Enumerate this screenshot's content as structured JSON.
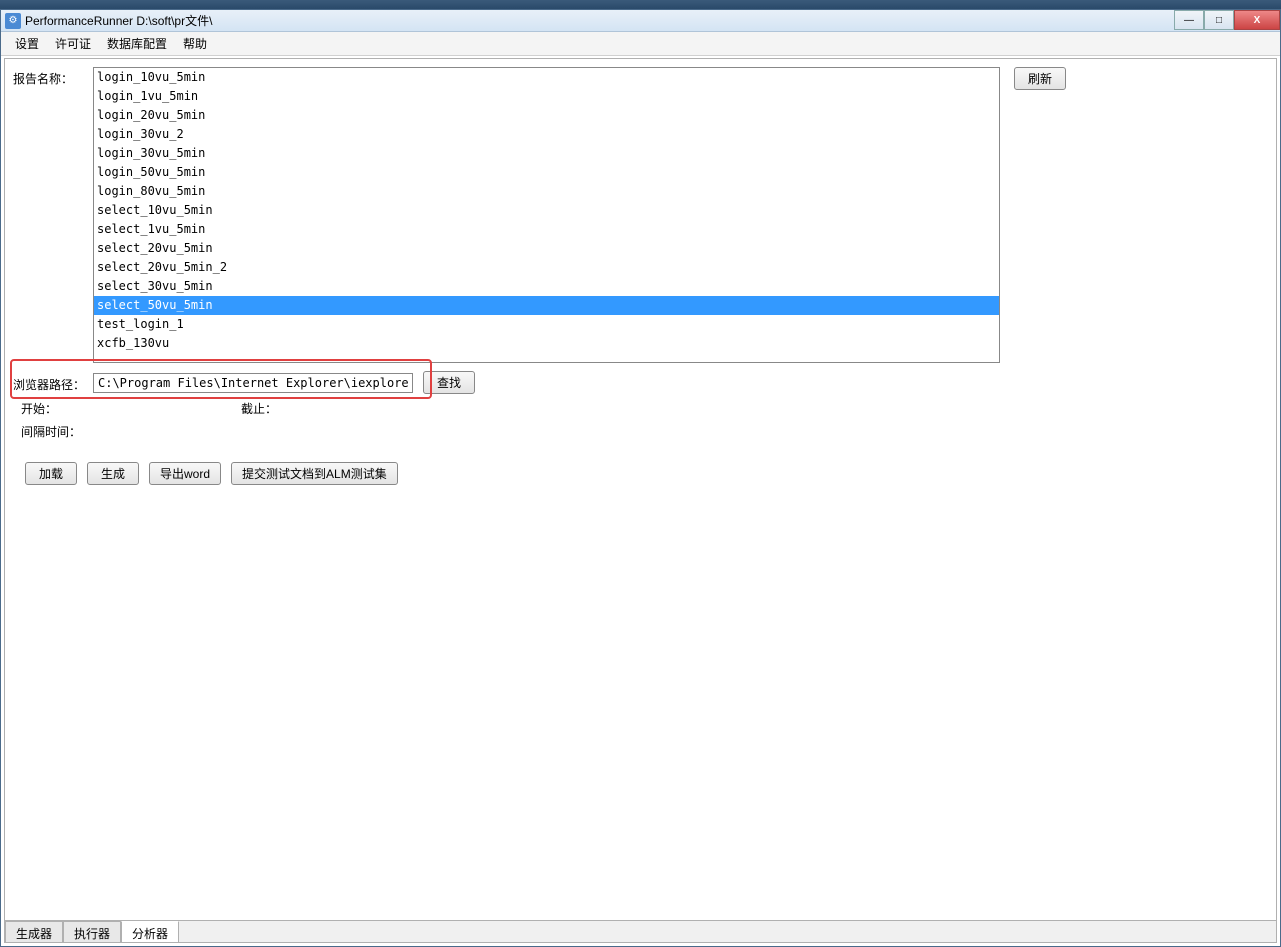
{
  "titlebar": {
    "app_title": "PerformanceRunner  D:\\soft\\pr文件\\"
  },
  "menubar": {
    "items": [
      "设置",
      "许可证",
      "数据库配置",
      "帮助"
    ]
  },
  "labels": {
    "report_name": "报告名称：",
    "browser_path": "浏览器路径：",
    "start": "开始：",
    "end": "截止：",
    "interval": "间隔时间："
  },
  "report_list": {
    "items": [
      "login_10vu_5min",
      "login_1vu_5min",
      "login_20vu_5min",
      "login_30vu_2",
      "login_30vu_5min",
      "login_50vu_5min",
      "login_80vu_5min",
      "select_10vu_5min",
      "select_1vu_5min",
      "select_20vu_5min",
      "select_20vu_5min_2",
      "select_30vu_5min",
      "select_50vu_5min",
      "test_login_1",
      "xcfb_130vu"
    ],
    "selected_index": 12
  },
  "browser_path_value": "C:\\Program Files\\Internet Explorer\\iexplore.exe",
  "buttons": {
    "refresh": "刷新",
    "find": "查找",
    "load": "加载",
    "generate": "生成",
    "export_word": "导出word",
    "submit_alm": "提交测试文档到ALM测试集"
  },
  "bottom_tabs": {
    "items": [
      "生成器",
      "执行器",
      "分析器"
    ],
    "active_index": 2
  },
  "win_controls": {
    "minimize": "—",
    "maximize": "□",
    "close": "X"
  }
}
